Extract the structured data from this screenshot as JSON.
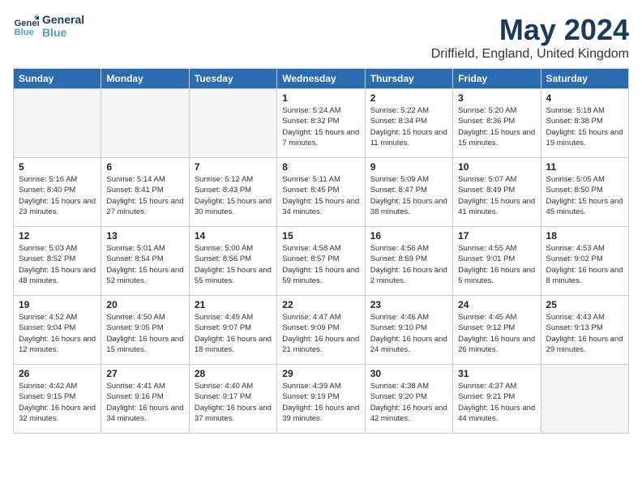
{
  "header": {
    "logo_general": "General",
    "logo_blue": "Blue",
    "month": "May 2024",
    "location": "Driffield, England, United Kingdom"
  },
  "weekdays": [
    "Sunday",
    "Monday",
    "Tuesday",
    "Wednesday",
    "Thursday",
    "Friday",
    "Saturday"
  ],
  "weeks": [
    {
      "days": [
        {
          "num": "",
          "info": "",
          "empty": true
        },
        {
          "num": "",
          "info": "",
          "empty": true
        },
        {
          "num": "",
          "info": "",
          "empty": true
        },
        {
          "num": "1",
          "info": "Sunrise: 5:24 AM\nSunset: 8:32 PM\nDaylight: 15 hours\nand 7 minutes.",
          "empty": false
        },
        {
          "num": "2",
          "info": "Sunrise: 5:22 AM\nSunset: 8:34 PM\nDaylight: 15 hours\nand 11 minutes.",
          "empty": false
        },
        {
          "num": "3",
          "info": "Sunrise: 5:20 AM\nSunset: 8:36 PM\nDaylight: 15 hours\nand 15 minutes.",
          "empty": false
        },
        {
          "num": "4",
          "info": "Sunrise: 5:18 AM\nSunset: 8:38 PM\nDaylight: 15 hours\nand 19 minutes.",
          "empty": false
        }
      ]
    },
    {
      "days": [
        {
          "num": "5",
          "info": "Sunrise: 5:16 AM\nSunset: 8:40 PM\nDaylight: 15 hours\nand 23 minutes.",
          "empty": false
        },
        {
          "num": "6",
          "info": "Sunrise: 5:14 AM\nSunset: 8:41 PM\nDaylight: 15 hours\nand 27 minutes.",
          "empty": false
        },
        {
          "num": "7",
          "info": "Sunrise: 5:12 AM\nSunset: 8:43 PM\nDaylight: 15 hours\nand 30 minutes.",
          "empty": false
        },
        {
          "num": "8",
          "info": "Sunrise: 5:11 AM\nSunset: 8:45 PM\nDaylight: 15 hours\nand 34 minutes.",
          "empty": false
        },
        {
          "num": "9",
          "info": "Sunrise: 5:09 AM\nSunset: 8:47 PM\nDaylight: 15 hours\nand 38 minutes.",
          "empty": false
        },
        {
          "num": "10",
          "info": "Sunrise: 5:07 AM\nSunset: 8:49 PM\nDaylight: 15 hours\nand 41 minutes.",
          "empty": false
        },
        {
          "num": "11",
          "info": "Sunrise: 5:05 AM\nSunset: 8:50 PM\nDaylight: 15 hours\nand 45 minutes.",
          "empty": false
        }
      ]
    },
    {
      "days": [
        {
          "num": "12",
          "info": "Sunrise: 5:03 AM\nSunset: 8:52 PM\nDaylight: 15 hours\nand 48 minutes.",
          "empty": false
        },
        {
          "num": "13",
          "info": "Sunrise: 5:01 AM\nSunset: 8:54 PM\nDaylight: 15 hours\nand 52 minutes.",
          "empty": false
        },
        {
          "num": "14",
          "info": "Sunrise: 5:00 AM\nSunset: 8:56 PM\nDaylight: 15 hours\nand 55 minutes.",
          "empty": false
        },
        {
          "num": "15",
          "info": "Sunrise: 4:58 AM\nSunset: 8:57 PM\nDaylight: 15 hours\nand 59 minutes.",
          "empty": false
        },
        {
          "num": "16",
          "info": "Sunrise: 4:56 AM\nSunset: 8:59 PM\nDaylight: 16 hours\nand 2 minutes.",
          "empty": false
        },
        {
          "num": "17",
          "info": "Sunrise: 4:55 AM\nSunset: 9:01 PM\nDaylight: 16 hours\nand 5 minutes.",
          "empty": false
        },
        {
          "num": "18",
          "info": "Sunrise: 4:53 AM\nSunset: 9:02 PM\nDaylight: 16 hours\nand 8 minutes.",
          "empty": false
        }
      ]
    },
    {
      "days": [
        {
          "num": "19",
          "info": "Sunrise: 4:52 AM\nSunset: 9:04 PM\nDaylight: 16 hours\nand 12 minutes.",
          "empty": false
        },
        {
          "num": "20",
          "info": "Sunrise: 4:50 AM\nSunset: 9:05 PM\nDaylight: 16 hours\nand 15 minutes.",
          "empty": false
        },
        {
          "num": "21",
          "info": "Sunrise: 4:49 AM\nSunset: 9:07 PM\nDaylight: 16 hours\nand 18 minutes.",
          "empty": false
        },
        {
          "num": "22",
          "info": "Sunrise: 4:47 AM\nSunset: 9:09 PM\nDaylight: 16 hours\nand 21 minutes.",
          "empty": false
        },
        {
          "num": "23",
          "info": "Sunrise: 4:46 AM\nSunset: 9:10 PM\nDaylight: 16 hours\nand 24 minutes.",
          "empty": false
        },
        {
          "num": "24",
          "info": "Sunrise: 4:45 AM\nSunset: 9:12 PM\nDaylight: 16 hours\nand 26 minutes.",
          "empty": false
        },
        {
          "num": "25",
          "info": "Sunrise: 4:43 AM\nSunset: 9:13 PM\nDaylight: 16 hours\nand 29 minutes.",
          "empty": false
        }
      ]
    },
    {
      "days": [
        {
          "num": "26",
          "info": "Sunrise: 4:42 AM\nSunset: 9:15 PM\nDaylight: 16 hours\nand 32 minutes.",
          "empty": false
        },
        {
          "num": "27",
          "info": "Sunrise: 4:41 AM\nSunset: 9:16 PM\nDaylight: 16 hours\nand 34 minutes.",
          "empty": false
        },
        {
          "num": "28",
          "info": "Sunrise: 4:40 AM\nSunset: 9:17 PM\nDaylight: 16 hours\nand 37 minutes.",
          "empty": false
        },
        {
          "num": "29",
          "info": "Sunrise: 4:39 AM\nSunset: 9:19 PM\nDaylight: 16 hours\nand 39 minutes.",
          "empty": false
        },
        {
          "num": "30",
          "info": "Sunrise: 4:38 AM\nSunset: 9:20 PM\nDaylight: 16 hours\nand 42 minutes.",
          "empty": false
        },
        {
          "num": "31",
          "info": "Sunrise: 4:37 AM\nSunset: 9:21 PM\nDaylight: 16 hours\nand 44 minutes.",
          "empty": false
        },
        {
          "num": "",
          "info": "",
          "empty": true
        }
      ]
    }
  ]
}
